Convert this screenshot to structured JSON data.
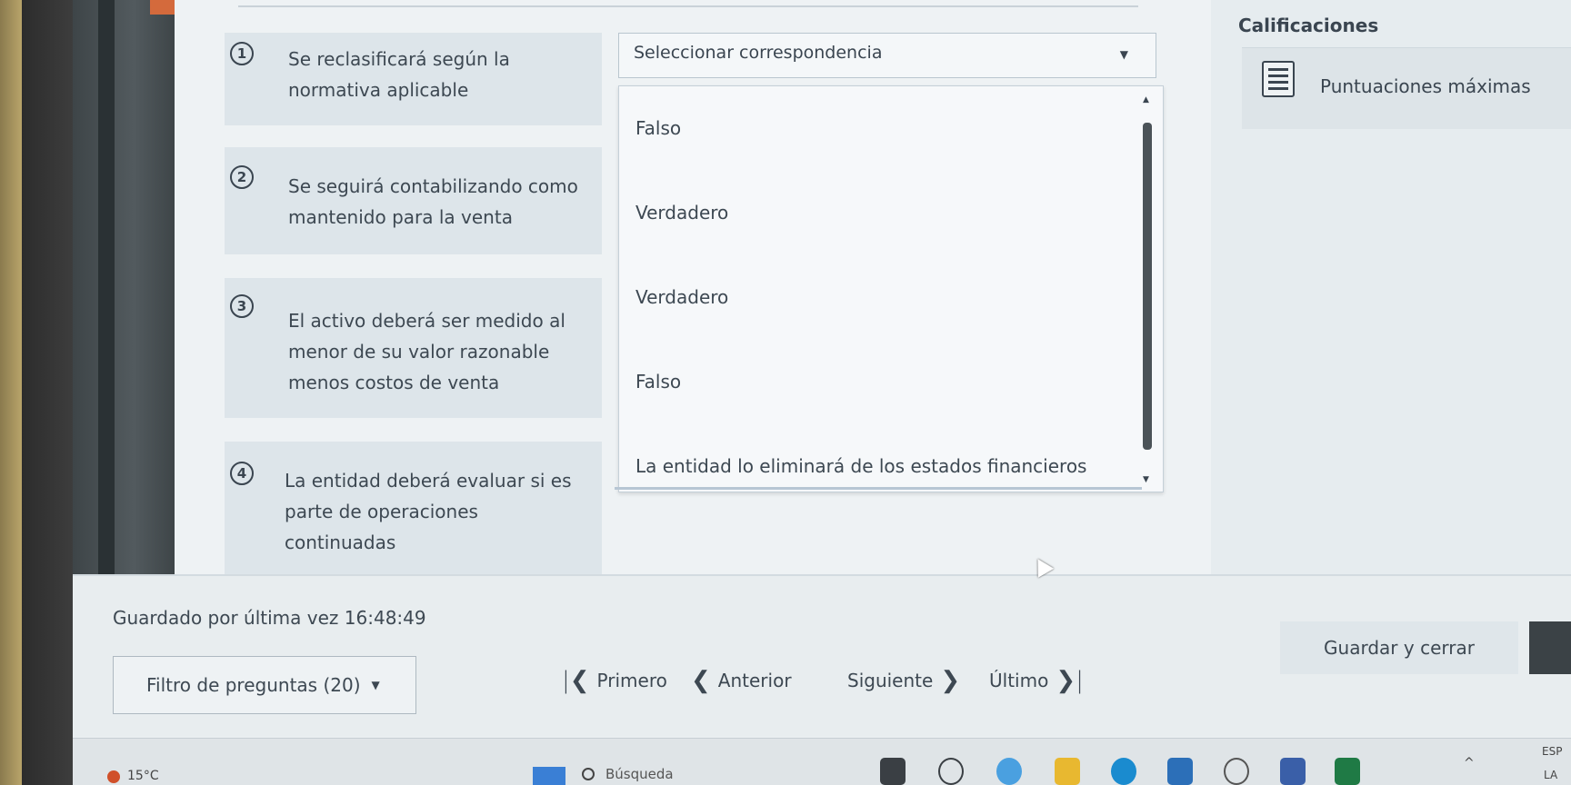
{
  "questions": [
    {
      "number": "1",
      "lines": [
        "Se reclasificará según la",
        "normativa aplicable"
      ]
    },
    {
      "number": "2",
      "lines": [
        "Se seguirá contabilizando como",
        "mantenido para la venta"
      ]
    },
    {
      "number": "3",
      "lines": [
        "El activo deberá ser medido al",
        "menor de su valor razonable",
        "menos costos de venta"
      ]
    },
    {
      "number": "4",
      "lines": [
        "La entidad deberá evaluar si es",
        "parte de operaciones",
        "continuadas"
      ]
    }
  ],
  "dropdown": {
    "selected": "Seleccionar correspondencia",
    "options": [
      "Falso",
      "Verdadero",
      "Verdadero",
      "Falso"
    ],
    "q4_value": "La entidad lo eliminará de los estados financieros"
  },
  "right_panel": {
    "title": "Calificaciones",
    "max_scores": "Puntuaciones máximas"
  },
  "footer": {
    "saved_label": "Guardado por última vez 16:48:49",
    "filter_label": "Filtro de preguntas (20)",
    "nav": {
      "first": "Primero",
      "prev": "Anterior",
      "next": "Siguiente",
      "last": "Último"
    },
    "save_close": "Guardar y cerrar"
  },
  "taskbar": {
    "temperature": "15°C",
    "search_placeholder": "Búsqueda",
    "lang_top": "ESP",
    "lang_bottom": "LA"
  },
  "colors": {
    "accent_orange": "#d46a3c",
    "start_blue": "#3a7fd5"
  }
}
